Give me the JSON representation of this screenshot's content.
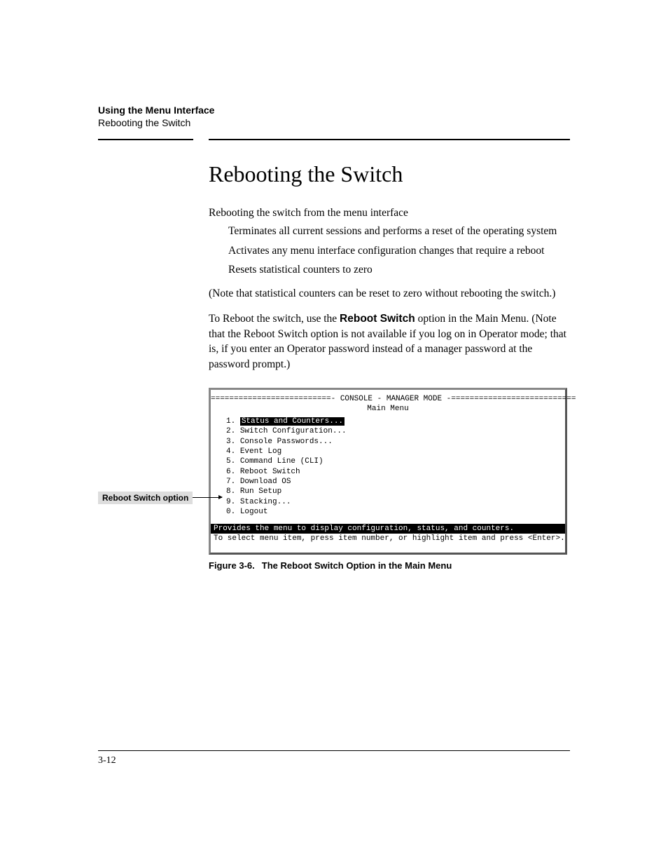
{
  "header": {
    "chapter": "Using the Menu Interface",
    "section": "Rebooting the Switch"
  },
  "title": "Rebooting the Switch",
  "intro": "Rebooting the switch from the menu interface",
  "bullets": [
    "Terminates all current sessions and performs a reset of the operating system",
    "Activates any menu interface configuration changes that require a reboot",
    "Resets statistical counters to zero"
  ],
  "note": "(Note that statistical counters can be reset to zero without rebooting the switch.)",
  "para2_pre": "To Reboot the switch, use the ",
  "para2_bold": "Reboot Switch",
  "para2_post": " option in the Main Menu. (Note that the Reboot Switch option is not available if you log on in Operator mode; that is, if you enter an Operator password instead of a manager password at the password prompt.)",
  "callout": "Reboot Switch option",
  "console": {
    "banner": "==========================- CONSOLE - MANAGER MODE -===========================",
    "menu_title": "Main Menu",
    "items": [
      {
        "num": "1.",
        "label": "Status and Counters...",
        "highlight": true
      },
      {
        "num": "2.",
        "label": "Switch Configuration..."
      },
      {
        "num": "3.",
        "label": "Console Passwords..."
      },
      {
        "num": "4.",
        "label": "Event Log"
      },
      {
        "num": "5.",
        "label": "Command Line (CLI)"
      },
      {
        "num": "6.",
        "label": "Reboot Switch"
      },
      {
        "num": "7.",
        "label": "Download OS"
      },
      {
        "num": "8.",
        "label": "Run Setup"
      },
      {
        "num": "9.",
        "label": "Stacking..."
      },
      {
        "num": "0.",
        "label": "Logout"
      }
    ],
    "status": "Provides the menu to display configuration, status, and counters.",
    "hint": "To select menu item, press item number, or highlight item and press <Enter>."
  },
  "figure": {
    "number": "Figure 3-6.",
    "caption": "The Reboot Switch Option in the Main Menu"
  },
  "page_number": "3-12"
}
